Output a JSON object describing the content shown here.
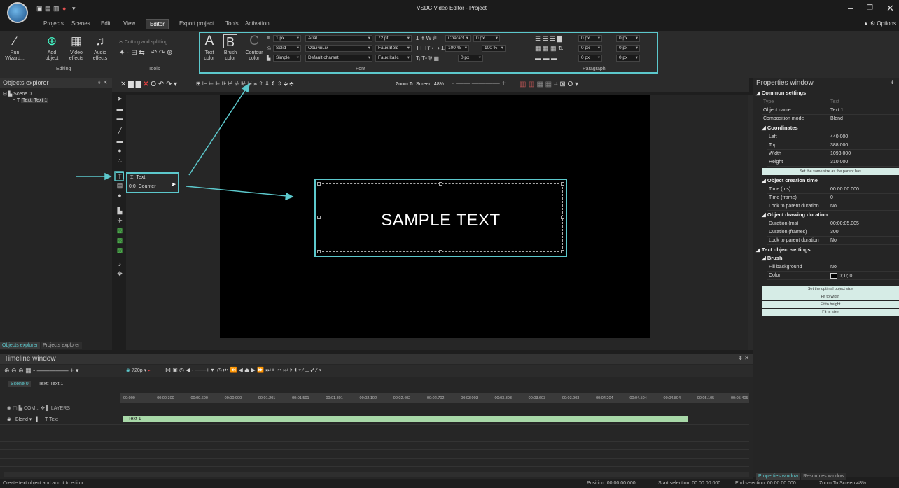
{
  "window": {
    "title": "VSDC Video Editor - Project",
    "options_label": "Options"
  },
  "menu": [
    "Projects",
    "Scenes",
    "Edit",
    "View",
    "Editor",
    "Export project",
    "Tools",
    "Activation"
  ],
  "ribbon": {
    "editing": {
      "group_label": "Editing",
      "run_wizard": "Run Wizard...",
      "add_object": "Add object",
      "video_effects": "Video effects",
      "audio_effects": "Audio effects"
    },
    "tools": {
      "group_label": "Tools",
      "cutting": "Cutting and splitting"
    },
    "font": {
      "group_label": "Font",
      "text_color": "Text color",
      "brush_color": "Brush color",
      "contour_color": "Contour color",
      "line_width": "1 px",
      "line_style": "Solid",
      "line_type": "Simple",
      "font_name": "Arial",
      "font_style": "Обычный",
      "charset": "Default charset",
      "font_size": "72 pt",
      "faux_bold": "Faux Bold",
      "faux_italic": "Faux Italic",
      "char_spacing": "Charact",
      "zero_px": "0 px",
      "scale_w": "100 %",
      "scale_h": "100 %"
    },
    "paragraph": {
      "group_label": "Paragraph",
      "zero_px": "0 px"
    }
  },
  "objects_explorer": {
    "title": "Objects explorer",
    "scene": "Scene 0",
    "text_item": "Text: Text 1",
    "tabs": [
      "Objects explorer",
      "Projects explorer"
    ]
  },
  "popup": {
    "text": "Text",
    "counter": "Counter"
  },
  "editor_toolbar": {
    "zoom_label": "Zoom To Screen",
    "zoom_value": "48%"
  },
  "canvas": {
    "sample_text": "SAMPLE TEXT"
  },
  "properties": {
    "title": "Properties window",
    "common": "Common settings",
    "rows1": [
      {
        "name": "Type",
        "value": "Text"
      },
      {
        "name": "Object name",
        "value": "Text 1"
      },
      {
        "name": "Composition mode",
        "value": "Blend"
      }
    ],
    "coords": "Coordinates",
    "rows2": [
      {
        "name": "Left",
        "value": "440.000"
      },
      {
        "name": "Top",
        "value": "388.000"
      },
      {
        "name": "Width",
        "value": "1093.000"
      },
      {
        "name": "Height",
        "value": "310.000"
      }
    ],
    "same_size_btn": "Set the same size as the parent has",
    "creation": "Object creation time",
    "rows3": [
      {
        "name": "Time (ms)",
        "value": "00:00:00.000"
      },
      {
        "name": "Time (frame)",
        "value": "0"
      },
      {
        "name": "Lock to parent duration",
        "value": "No"
      }
    ],
    "duration": "Object drawing duration",
    "rows4": [
      {
        "name": "Duration (ms)",
        "value": "00:00:05.005"
      },
      {
        "name": "Duration (frames)",
        "value": "300"
      },
      {
        "name": "Lock to parent duration",
        "value": "No"
      }
    ],
    "text_settings": "Text object settings",
    "brush": "Brush",
    "rows5": [
      {
        "name": "Fill background",
        "value": "No"
      },
      {
        "name": "Color",
        "value": "0; 0; 0"
      }
    ],
    "btns": [
      "Set the optimal object size",
      "Fit to width",
      "Fit to height",
      "Fit to size"
    ],
    "tabs": [
      "Properties window",
      "Resources window"
    ]
  },
  "timeline": {
    "title": "Timeline window",
    "resolution": "720p",
    "tabs": [
      "Scene 0",
      "Text: Text 1"
    ],
    "layers_label": "LAYERS",
    "com_label": "COM...",
    "blend_label": "Blend",
    "text_label": "Text",
    "clip_label": "Text 1",
    "ticks": [
      "00:000",
      "00:00.300",
      "00:00.600",
      "00:00.900",
      "00:01.201",
      "00:01.501",
      "00:01.801",
      "00:02.102",
      "00:02.402",
      "00:02.702",
      "00:03.003",
      "00:03.303",
      "00:03.603",
      "00:03.903",
      "00:04.204",
      "00:04.504",
      "00:04.804",
      "00:05.105",
      "00:05.405"
    ]
  },
  "status": {
    "left": "Create text object and add it to editor",
    "position": "Position:  00:00:00.000",
    "start_sel": "Start selection:  00:00:00.000",
    "end_sel": "End selection:  00:00:00.000",
    "zoom": "Zoom To Screen   48%"
  }
}
